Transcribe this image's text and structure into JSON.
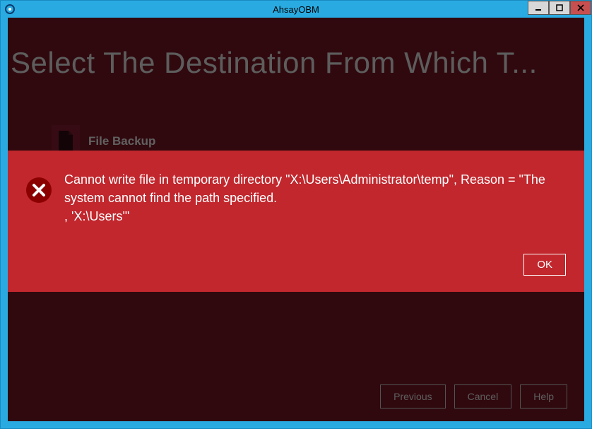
{
  "window": {
    "title": "AhsayOBM"
  },
  "page": {
    "heading": "Select The Destination From Which T..."
  },
  "backup_item": {
    "label": "File Backup"
  },
  "error": {
    "message_line1": "Cannot write file in temporary directory \"X:\\Users\\Administrator\\temp\", Reason = \"The system cannot find the path specified.",
    "message_line2": ", 'X:\\Users'\"",
    "ok_label": "OK"
  },
  "footer": {
    "previous": "Previous",
    "cancel": "Cancel",
    "help": "Help"
  }
}
